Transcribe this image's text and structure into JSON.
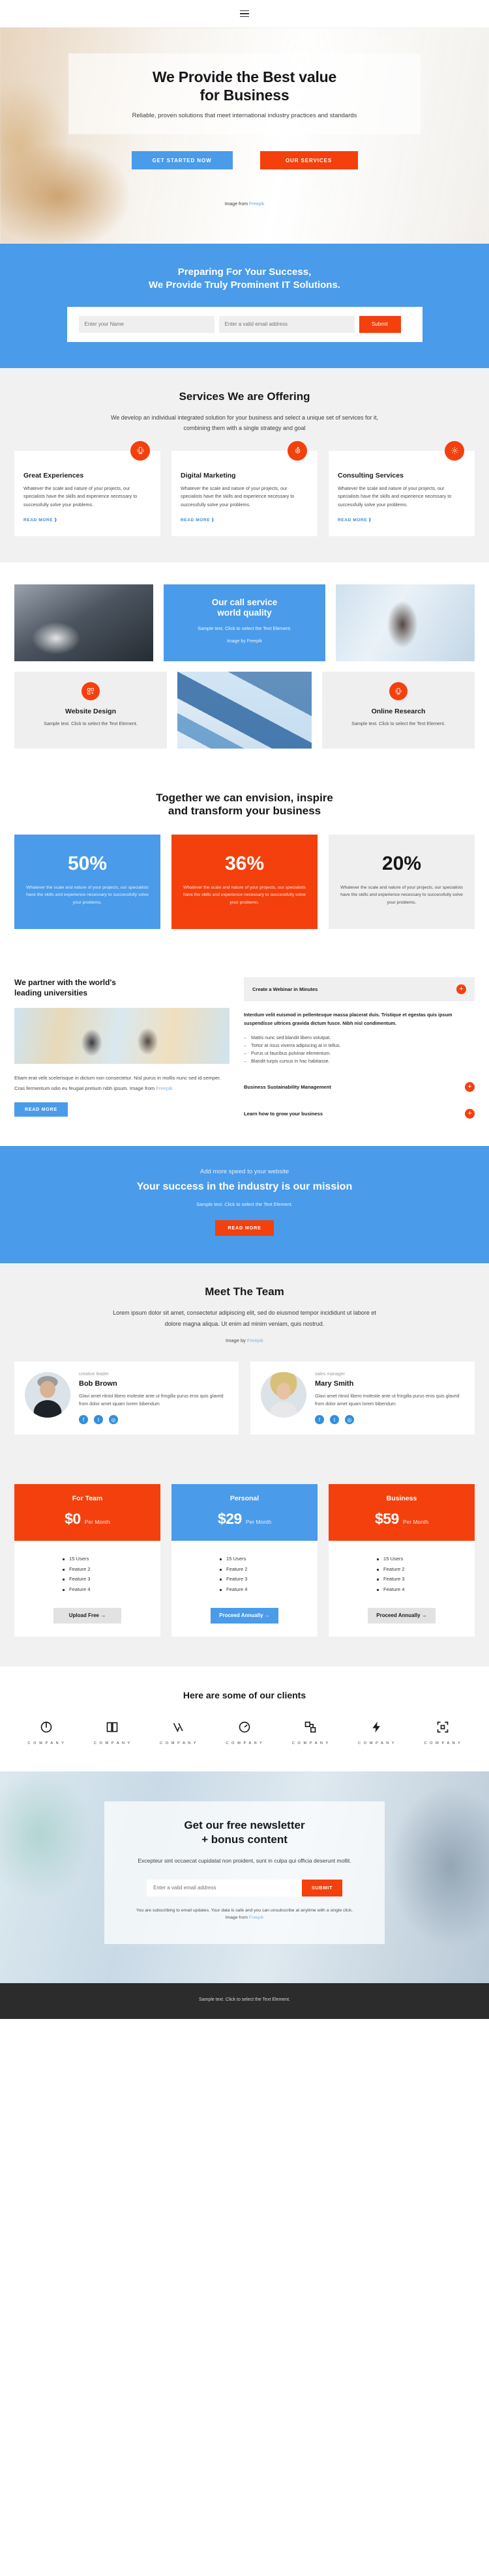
{
  "topbar": {
    "menu_icon": "hamburger-menu-icon"
  },
  "hero": {
    "title_line1": "We Provide the Best value",
    "title_line2": "for Business",
    "subtitle": "Reliable, proven solutions that meet international industry practices and standards",
    "primary_button": "GET STARTED NOW",
    "secondary_button": "OUR SERVICES",
    "credit_prefix": "Image from ",
    "credit_link": "Freepik"
  },
  "subscribe_band": {
    "title_line1": "Preparing For Your Success,",
    "title_line2": "We Provide Truly Prominent IT Solutions.",
    "name_placeholder": "Enter your Name",
    "email_placeholder": "Enter a valid email address",
    "submit_label": "Submit"
  },
  "services": {
    "title": "Services We are Offering",
    "lead": "We develop an individual integrated solution for your business and select a unique set of services for it, combining them with a single strategy and goal",
    "read_more": "READ MORE ⟫",
    "cards": [
      {
        "icon": "mobile-signal-icon",
        "title": "Great Experiences",
        "text": "Whatever the scale and nature of your projects, our specialists have the skills and experience necessary to successfully solve your problems."
      },
      {
        "icon": "target-icon",
        "title": "Digital Marketing",
        "text": "Whatever the scale and nature of your projects, our specialists have the skills and experience necessary to successfully solve your problems."
      },
      {
        "icon": "gear-icon",
        "title": "Consulting Services",
        "text": "Whatever the scale and nature of your projects, our specialists have the skills and experience necessary to successfully solve your problems."
      }
    ]
  },
  "gallery": {
    "call_title_line1": "Our call service",
    "call_title_line2": "world quality",
    "call_text": "Sample text. Click to select the Text Element.",
    "call_credit": "Image by Freepik",
    "tiles": [
      {
        "icon": "layout-add-icon",
        "title": "Website Design",
        "text": "Sample text. Click to select the Text Element."
      },
      {
        "icon": "mobile-signal-icon",
        "title": "Online Research",
        "text": "Sample text. Click to select the Text Element."
      }
    ]
  },
  "stats": {
    "title_line1": "Together we can envision, inspire",
    "title_line2": "and transform your business",
    "items": [
      {
        "value": "50%",
        "text": "Whatever the scale and nature of your projects, our specialists have the skills and experience necessary to successfully solve your problems.",
        "color": "#4a9bea"
      },
      {
        "value": "36%",
        "text": "Whatever the scale and nature of your projects, our specialists have the skills and experience necessary to successfully solve your problems.",
        "color": "#f4400d"
      },
      {
        "value": "20%",
        "text": "Whatever the scale and nature of your projects, our specialists have the skills and experience necessary to successfully solve your problems.",
        "color": "#efefef"
      }
    ]
  },
  "universities": {
    "title_line1": "We partner with the world's",
    "title_line2": "leading universities",
    "body": "Etiam erat velit scelerisque in dictum non consectetur. Nisl purus in mollis nunc sed id semper. Cras fermentum odio eu feugiat pretium nibh ipsum. Image from ",
    "body_link": "Freepik",
    "read_more": "READ MORE",
    "accordion_top": "Create a Webinar in Minutes",
    "paragraph": "Interdum velit euismod in pellentesque massa placerat duis. Tristique et egestas quis ipsum suspendisse ultrices gravida dictum fusce. Nibh nisl condimentum.",
    "bullets": [
      "Mattis nunc sed blandit libero volutpat.",
      "Tortor at risus viverra adipiscing at in tellus.",
      "Purus ut faucibus pulvinar elementum.",
      "Blandit turpis cursus in hac habitasse."
    ],
    "accordion_items": [
      "Business Sustainability Management",
      "Learn how to grow your business"
    ]
  },
  "mission": {
    "eyebrow": "Add more speed to your website",
    "title": "Your success in the industry is our mission",
    "sample": "Sample text. Click to select the Text Element.",
    "button": "READ MORE"
  },
  "team": {
    "title": "Meet The Team",
    "lead": "Lorem ipsum dolor sit amet, consectetur adipiscing elit, sed do eiusmod tempor incididunt ut labore et dolore magna aliqua. Ut enim ad minim veniam, quis nostrud.",
    "credit_prefix": "Image by ",
    "credit_link": "Freepik",
    "members": [
      {
        "role": "creative leader",
        "name": "Bob Brown",
        "bio": "Glavi amet ritnisl libero molestie ante ut fringilla purus eros quis glavrid from dolor amet iquam lorem bibendum",
        "socials": [
          "facebook-icon",
          "twitter-icon",
          "instagram-icon"
        ]
      },
      {
        "role": "sales manager",
        "name": "Mary Smith",
        "bio": "Glavi amet ritnisl libero molestie ante ut fringilla purus eros quis glavrid from dolor amet iquam lorem bibendum",
        "socials": [
          "facebook-icon",
          "twitter-icon",
          "instagram-icon"
        ]
      }
    ]
  },
  "pricing": {
    "plans": [
      {
        "name": "For Team",
        "amount": "$0",
        "per": "Per Month",
        "head_color": "#f4400d",
        "features": [
          "15 Users",
          "Feature 2",
          "Feature 3",
          "Feature 4"
        ],
        "cta": "Upload Free →",
        "cta_style": "grey"
      },
      {
        "name": "Personal",
        "amount": "$29",
        "per": "Per Month",
        "head_color": "#4a9bea",
        "features": [
          "15 Users",
          "Feature 2",
          "Feature 3",
          "Feature 4"
        ],
        "cta": "Proceed Annually →",
        "cta_style": "blue"
      },
      {
        "name": "Business",
        "amount": "$59",
        "per": "Per Month",
        "head_color": "#f4400d",
        "features": [
          "15 Users",
          "Feature 2",
          "Feature 3",
          "Feature 4"
        ],
        "cta": "Proceed Annually →",
        "cta_style": "grey"
      }
    ]
  },
  "clients": {
    "title": "Here are some of our clients",
    "logos": [
      {
        "icon": "circle-swirl-logo-icon",
        "label": "C O M P A N Y"
      },
      {
        "icon": "open-book-logo-icon",
        "label": "C O M P A N Y"
      },
      {
        "icon": "double-chevron-logo-icon",
        "label": "C O M P A N Y"
      },
      {
        "icon": "clock-arrow-logo-icon",
        "label": "C O M P A N Y"
      },
      {
        "icon": "squares-link-logo-icon",
        "label": "C O M P A N Y"
      },
      {
        "icon": "lightning-bolt-logo-icon",
        "label": "C O M P A N Y"
      },
      {
        "icon": "brackets-grid-logo-icon",
        "label": "C O M P A N Y"
      }
    ]
  },
  "newsletter": {
    "title_line1": "Get our free newsletter",
    "title_line2": "+ bonus content",
    "lead": "Excepteur sint occaecat cupidatat non proident, sunt in culpa qui officia deserunt mollit.",
    "email_placeholder": "Enter a valid email address",
    "submit_label": "SUBMIT",
    "fine_print": "You are subscribing to email updates. Your data is safe and you can unsubscribe at anytime with a single click.",
    "credit_prefix": "Image from ",
    "credit_link": "Freepik"
  },
  "footer": {
    "text": "Sample text. Click to select the Text Element."
  },
  "colors": {
    "accent_blue": "#4a9bea",
    "accent_red": "#f4400d",
    "dark": "#2c2c2c"
  }
}
